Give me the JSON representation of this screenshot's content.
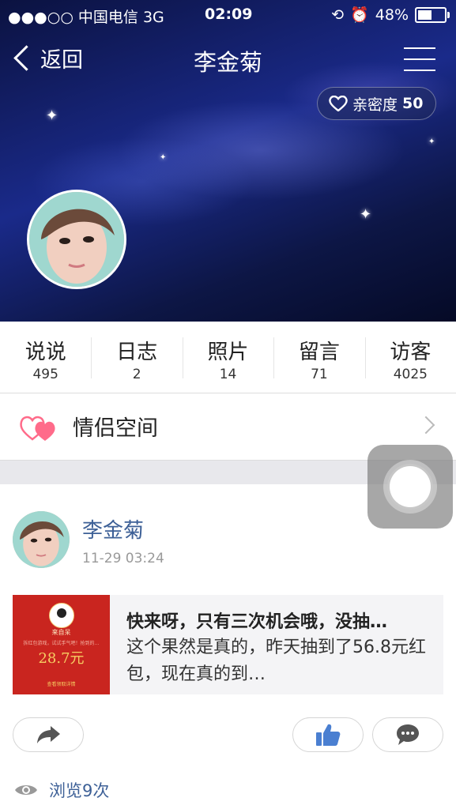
{
  "status_bar": {
    "carrier": "●●●○○ 中国电信  3G",
    "time": "02:09",
    "battery": "48%"
  },
  "nav": {
    "back_label": "返回",
    "title": "李金菊"
  },
  "intimacy": {
    "label": "亲密度",
    "value": "50"
  },
  "stats": [
    {
      "label": "说说",
      "count": "495"
    },
    {
      "label": "日志",
      "count": "2"
    },
    {
      "label": "照片",
      "count": "14"
    },
    {
      "label": "留言",
      "count": "71"
    },
    {
      "label": "访客",
      "count": "4025"
    }
  ],
  "couple_space": {
    "label": "情侣空间"
  },
  "post": {
    "author": "李金菊",
    "time": "11-29 03:24",
    "card": {
      "title": "快来呀，只有三次机会哦，没抽…",
      "description": "这个果然是真的，昨天抽到了56.8元红包，现在真的到…",
      "thumb_from": "来自呆",
      "thumb_sub": "拆红包游戏，试试手气吧！抢到的…",
      "thumb_amount": "28.7元",
      "thumb_link": "查看领取详情"
    }
  },
  "views": {
    "label": "浏览9次"
  },
  "colors": {
    "link_blue": "#3c5f96",
    "like_blue": "#4a7fd1",
    "heart_pink": "#ff6b8a"
  },
  "icons": [
    "back-icon",
    "menu-icon",
    "heart-icon",
    "couple-hearts-icon",
    "chevron-right-icon",
    "share-icon",
    "like-icon",
    "comment-icon",
    "eye-icon"
  ]
}
